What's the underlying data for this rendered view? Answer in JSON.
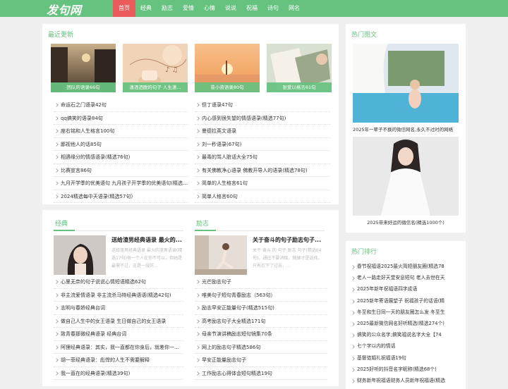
{
  "site": {
    "logo": "发句网"
  },
  "nav": [
    {
      "label": "首页",
      "active": true
    },
    {
      "label": "经典"
    },
    {
      "label": "励志"
    },
    {
      "label": "爱情"
    },
    {
      "label": "心情"
    },
    {
      "label": "说说"
    },
    {
      "label": "祝福"
    },
    {
      "label": "诗句"
    },
    {
      "label": "网名"
    }
  ],
  "recent": {
    "title": "最近更新",
    "pics": [
      {
        "caption": "团队的语录66句"
      },
      {
        "caption": "潇洒洒脱的句子 人生潇..."
      },
      {
        "caption": "昔小资语录80句"
      },
      {
        "caption": "张爱以格言61句"
      }
    ],
    "left": [
      "命运石之门语录42句",
      "qq搞笑的语录84句",
      "座右铭和人生格言100句",
      "鄙视他人的话85句",
      "相遇缘分的情感语录(精选76句)",
      "比赛宣言86句",
      "九月开学季的优美语句 九月孩子开学季的优美语句(精选5...",
      "2024精选每中天语录(精选57句)"
    ],
    "right": [
      "但丁语录47句",
      "内心感到很失望的情感语录(精选77句)",
      "曼德拉英文语录",
      "刘一秒语录(67句)",
      "最毒的骂人脏话大全75句",
      "有关佛教净心语录 佛教开导人的语录(精选78句)",
      "简单的人生格言61句",
      "简单人格言60句"
    ]
  },
  "classic": {
    "title": "经典",
    "feature_title": "送给渣男经典语录 最火的...",
    "feature_desc": "送给渣男经典语录 最火的渣男语录(精选17句)每一个人在你不可以，但她是最需不过，这是一段防...",
    "items": [
      "心里无奈的句子说说心情短语精选62句",
      "非主流爱情语录 非主流杀马特经典语语(精选42句)",
      "志明与春娇经典台词",
      "做自己人生中的女王语录 生日做自己的女王语录",
      "致青春那微经典语录 经典台词",
      "阿狸经典语录：其实，我一直都在你身后，就差你一个...",
      "胡一菲经典语录：彪悍的人生不需要解释",
      "我一直在的经典语录(精选39句)"
    ]
  },
  "inspire": {
    "title": "励志",
    "feature_title": "关于奋斗的句子励志句子...",
    "feature_desc": "关于 奋斗 的 句子 励志 句子(精选64句)，通往不要消极，随便才是选择。只有忍下了过去，...",
    "items": [
      "光芒励志句子",
      "唯美句子短句青春励志（563句）",
      "励志早安正能量句子(精选515句)",
      "高考励志句子大全精选171句",
      "母亲节演讲稿励志短句镜集70条",
      "网上的励志句子精选586句",
      "早安正能量励志句子",
      "工作励志心得体会短句精选19句"
    ]
  },
  "hotpic": {
    "title": "热门图文",
    "captions": [
      "2025年一辈子不换的微信网名,永久不过时的网络",
      "2025带来好运的微信名(精选1000个)"
    ]
  },
  "hotrank": {
    "title": "热门排行",
    "items": [
      "春节祝福语2025最火简短朋友圈(精选78",
      "老人一路走好天堂安息短句 老人去世在天",
      "2025年新年祝福语四字成语",
      "2025新年寄语展望子 祝福孩子的话语(精",
      "冬至和生日同一天的朋友圈怎么发 冬至生",
      "2025最新微信网名好听精选(精选274个)",
      "搞笑的公众名字;搞笑福说名字大全【74",
      "七个字以内的情话",
      "基督徒婚礼祝福语19句",
      "2025好听的抖音名字昵称(精选68个)",
      "财务新年祝福语财务人员新年祝福语(精选"
    ]
  }
}
